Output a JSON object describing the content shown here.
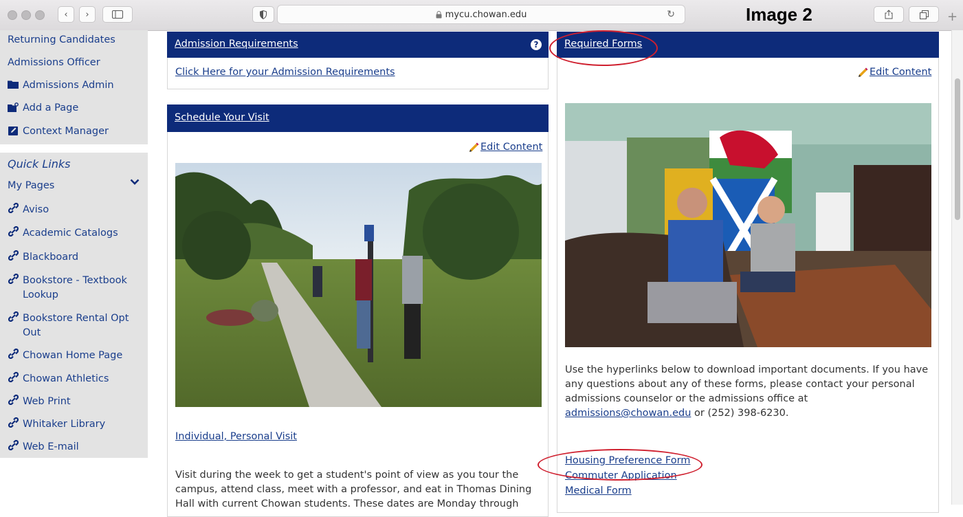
{
  "browser": {
    "url": "mycu.chowan.edu",
    "image_label": "Image 2"
  },
  "sidebar": {
    "admin_items": [
      {
        "label": "Returning Candidates",
        "icon": ""
      },
      {
        "label": "Admissions Officer",
        "icon": ""
      },
      {
        "label": "Admissions Admin",
        "icon": "folder-icon"
      },
      {
        "label": "Add a Page",
        "icon": "add-folder-icon"
      },
      {
        "label": "Context Manager",
        "icon": "edit-square-icon"
      }
    ],
    "quick_links_title": "Quick Links",
    "my_pages_label": "My Pages",
    "links": [
      "Aviso",
      "Academic Catalogs",
      "Blackboard",
      "Bookstore - Textbook Lookup",
      "Bookstore Rental Opt Out",
      "Chowan Home Page",
      "Chowan Athletics",
      "Web Print",
      "Whitaker Library",
      "Web E-mail"
    ]
  },
  "admission": {
    "title": "Admission Requirements",
    "help": "?",
    "link": "Click Here for your Admission Requirements"
  },
  "visit": {
    "title": "Schedule Your Visit",
    "edit": "Edit Content",
    "individual": "Individual, Personal Visit ",
    "text_line1": "Visit during the week to get a student's point of view as you tour the",
    "text_line2": "campus, attend class, meet with a professor, and eat in Thomas Dining",
    "text_line3": "Hall with current Chowan students. These dates are Monday through"
  },
  "forms": {
    "title": "Required Forms",
    "edit": "Edit Content",
    "p_line1": "Use the hyperlinks below to download important documents. If you have",
    "p_line2": "any questions about any of these forms, please contact your personal",
    "p_line3": "admissions counselor or the admissions office at",
    "email": "admissions@chowan.edu",
    "phone": " or (252) 398-6230.",
    "housing": "Housing Preference Form",
    "commuter": "Commuter Application",
    "medical": "Medical Form"
  },
  "colors": {
    "header_bg": "#0d2b7a",
    "link": "#1a3e8c",
    "annotation": "#cf1f2e",
    "sidebar_bg": "#e3e3e3"
  }
}
